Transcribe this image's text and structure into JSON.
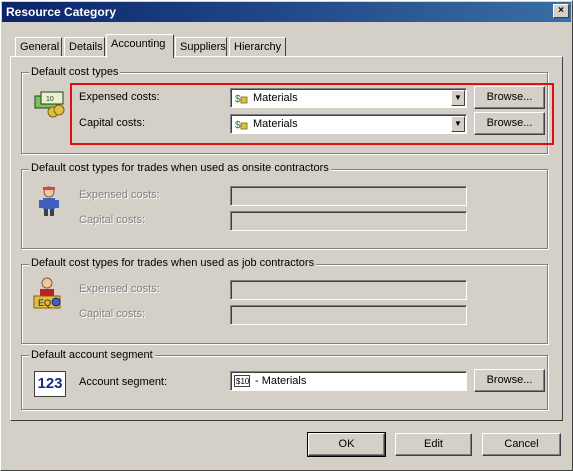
{
  "window": {
    "title": "Resource Category",
    "close_glyph": "×"
  },
  "tabs": [
    {
      "label": "General"
    },
    {
      "label": "Details"
    },
    {
      "label": "Accounting"
    },
    {
      "label": "Suppliers"
    },
    {
      "label": "Hierarchy"
    }
  ],
  "default_cost_types": {
    "title": "Default cost types",
    "expensed_label": "Expensed costs:",
    "expensed_value": "Materials",
    "capital_label": "Capital costs:",
    "capital_value": "Materials",
    "browse_label": "Browse..."
  },
  "onsite_contractors": {
    "title": "Default cost types for trades when used as onsite contractors",
    "expensed_label": "Expensed costs:",
    "capital_label": "Capital costs:"
  },
  "job_contractors": {
    "title": "Default cost types for trades when used as job contractors",
    "expensed_label": "Expensed costs:",
    "capital_label": "Capital costs:"
  },
  "account_segment": {
    "title": "Default account segment",
    "icon_text": "123",
    "label": "Account segment:",
    "value": "- Materials",
    "browse_label": "Browse..."
  },
  "footer": {
    "ok_label": "OK",
    "edit_label": "Edit",
    "cancel_label": "Cancel"
  },
  "colors": {
    "highlight": "#e01010",
    "title_bar": "#0a246a"
  },
  "icons": [
    "money-icon",
    "contractor-icon",
    "job-contractor-icon",
    "number-123-icon",
    "dollar-resource-icon",
    "dropdown-arrow-icon"
  ]
}
